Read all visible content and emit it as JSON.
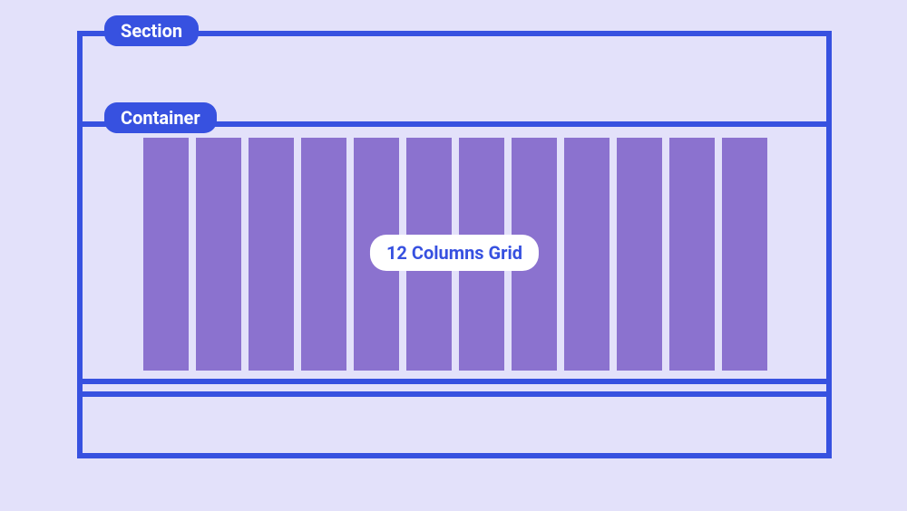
{
  "labels": {
    "section": "Section",
    "container": "Container",
    "grid": "12 Columns Grid"
  },
  "grid": {
    "columns": 12
  },
  "colors": {
    "background": "#e3e1fa",
    "border": "#3751e0",
    "column": "#8b72cf",
    "pill_bg": "#3751e0",
    "pill_text": "#ffffff",
    "grid_label_bg": "#ffffff",
    "grid_label_text": "#3751e0"
  }
}
